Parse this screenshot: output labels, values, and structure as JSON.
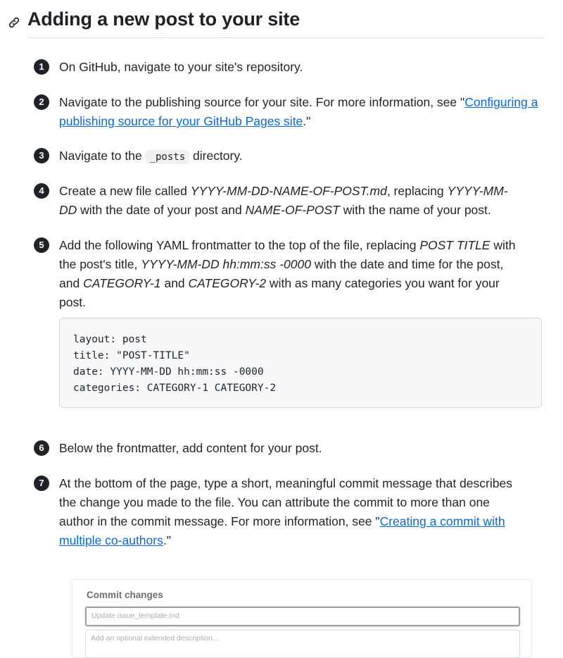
{
  "heading": {
    "icon": "link-icon",
    "title": "Adding a new post to your site"
  },
  "steps": [
    {
      "num": "1",
      "parts": [
        "On GitHub, navigate to your site's repository."
      ]
    },
    {
      "num": "2",
      "text_a": "Navigate to the publishing source for your site. For more information, see \"",
      "link": "Configuring a publishing source for your GitHub Pages site",
      "text_b": ".\""
    },
    {
      "num": "3",
      "text_a": "Navigate to the ",
      "code": "_posts",
      "text_b": " directory."
    },
    {
      "num": "4",
      "t1": "Create a new file called ",
      "i1": "YYYY-MM-DD-NAME-OF-POST.md",
      "t2": ", replacing ",
      "i2": "YYYY-MM-",
      "i3": "DD",
      "t3": " with the date of your post and ",
      "i4": "NAME-OF-POST",
      "t4": " with the name of your post."
    },
    {
      "num": "5",
      "t1": "Add the following YAML frontmatter to the top of the file, replacing ",
      "i1": "POST TITLE",
      "t2": " with",
      "t3": "the post's title, ",
      "i2": "YYYY-MM-DD hh:mm:ss -0000",
      "t4": " with the date and time for the post,",
      "t5": "and ",
      "i3": "CATEGORY-1",
      "t6": " and ",
      "i4": "CATEGORY-2",
      "t7": " with as many categories you want for your",
      "t8": "post."
    },
    {
      "num": "6",
      "text": "Below the frontmatter, add content for your post."
    },
    {
      "num": "7",
      "line1": "At the bottom of the page, type a short, meaningful commit message that describes",
      "line2": "the change you made to the file. You can attribute the commit to more than one",
      "line3a": "author in the commit message. For more information, see \"",
      "link_a": "Creating a commit with",
      "link_b": "multiple co-authors",
      "line4b": ".\""
    }
  ],
  "code_block": {
    "lines": [
      "layout: post",
      "title: \"POST-TITLE\"",
      "date: YYYY-MM-DD hh:mm:ss -0000",
      "categories: CATEGORY-1 CATEGORY-2"
    ]
  },
  "commit_dialog": {
    "title": "Commit changes",
    "summary_placeholder": "Update issue_template.md",
    "description_placeholder": "Add an optional extended description..."
  }
}
